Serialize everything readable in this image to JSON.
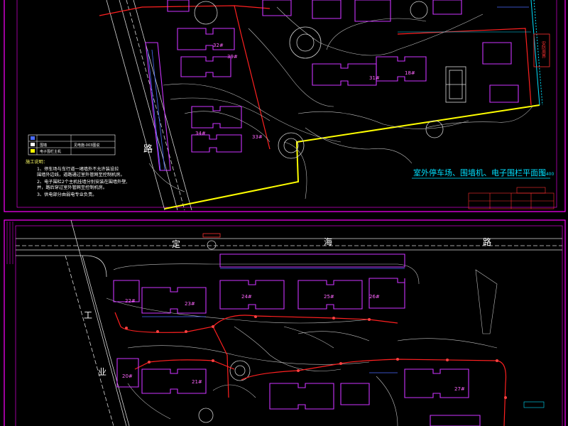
{
  "colors": {
    "background": "#000000",
    "frame": "#ff00ff",
    "road": "#d8d8d8",
    "fence": "#ff2020",
    "building": "#cc33ff",
    "parking": "#4a6cff",
    "landscape": "#c0c0c0",
    "boundary": "#ffff00",
    "callout": "#00e0ff",
    "stamp": "#ff3030",
    "notes": "#ffffff",
    "notes_title": "#ffff66"
  },
  "sheet1": {
    "title": "室外停车场、围墙机、电子围栏平面图",
    "scale": "1:400",
    "road_char": "路",
    "legend": {
      "rows": [
        {
          "code": "■",
          "text": "",
          "extra": ""
        },
        {
          "code": "□",
          "text": "围墙",
          "extra": "见电施-003图说"
        },
        {
          "code": "■",
          "text": "电子围栏主机",
          "extra": ""
        }
      ]
    },
    "notes": {
      "title": "施工说明：",
      "lines": [
        "1、停车场与车行道一堵墙外不允许装设拉",
        "    围墙外边线，道路通过室外管网至控制机房。",
        "2、电子围栏2个主机挂墙分别安装在围墙外壁,",
        "    并，路后穿过室外管网至控制机房。",
        "3、供电部分由弱电专业负责。"
      ]
    },
    "building_labels": [
      "39#",
      "34#",
      "18#",
      "33#",
      "32#",
      "31#"
    ],
    "stamp": "安防周界"
  },
  "sheet2": {
    "road_chars": [
      "定",
      "海",
      "路"
    ],
    "side_chars": [
      "工",
      "业"
    ],
    "building_labels": [
      "22#",
      "23#",
      "24#",
      "25#",
      "26#",
      "20#",
      "21#",
      "27#"
    ]
  }
}
